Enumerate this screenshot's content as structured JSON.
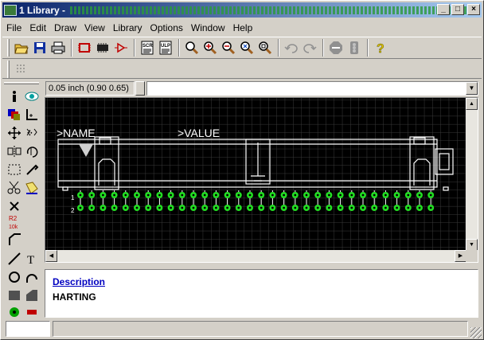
{
  "window": {
    "title": "1 Library - ",
    "minimize_label": "_",
    "maximize_label": "□",
    "close_label": "×"
  },
  "menu": [
    "File",
    "Edit",
    "Draw",
    "View",
    "Library",
    "Options",
    "Window",
    "Help"
  ],
  "toolbar": {
    "icons": [
      "open-icon",
      "save-icon",
      "print-icon",
      "schematic-icon",
      "package-icon",
      "symbol-icon",
      "script-icon",
      "ulp-icon",
      "zoom-fit-icon",
      "zoom-in-icon",
      "zoom-out-icon",
      "zoom-redraw-icon",
      "zoom-select-icon",
      "undo-icon",
      "redo-icon",
      "stop-icon",
      "go-icon",
      "help-icon"
    ],
    "script_label": "SCR",
    "ulp_label": "ULP"
  },
  "coordinates": "0.05 inch (0.90 0.65)",
  "command_line": "",
  "canvas": {
    "name_label": ">NAME",
    "value_label": ">VALUE",
    "pin_count": 32,
    "pin_labels": [
      "1",
      "2"
    ],
    "colors": {
      "background": "#000000",
      "grid": "#3a3a3a",
      "outline": "#ffffff",
      "pad": "#22dd22"
    }
  },
  "left_tools": [
    "info-icon",
    "eye-icon",
    "layer-icon",
    "mark-icon",
    "move-icon",
    "copy-icon",
    "mirror-icon",
    "rotate-icon",
    "group-icon",
    "change-icon",
    "cut-icon",
    "paste-icon",
    "delete-icon",
    "add-icon",
    "name-icon",
    "value-icon",
    "smash-icon",
    "miter-icon",
    "wire-icon",
    "text-icon",
    "circle-icon",
    "arc-icon",
    "rect-icon",
    "polygon-icon",
    "via-icon",
    "smd-icon"
  ],
  "left_labels": {
    "name_tool": "R2",
    "value_tool": "10k"
  },
  "description": {
    "heading": "Description",
    "text": "HARTING"
  },
  "status": {
    "field1": "",
    "field2": ""
  }
}
